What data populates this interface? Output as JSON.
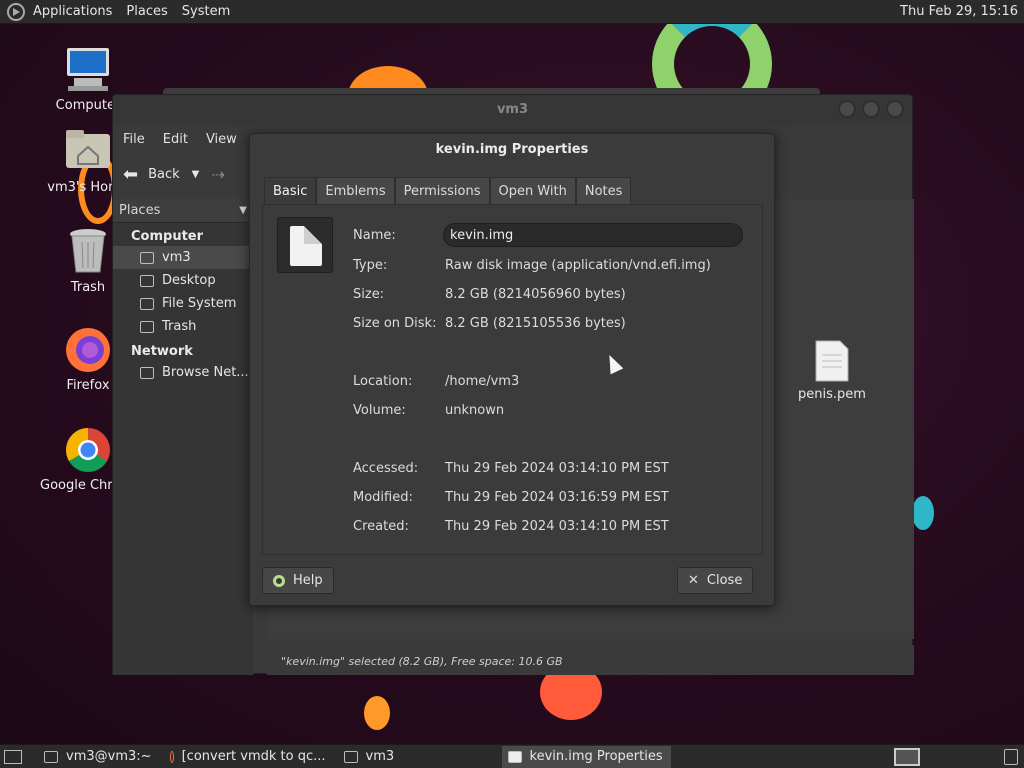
{
  "top_panel": {
    "menus": [
      "Applications",
      "Places",
      "System"
    ],
    "clock": "Thu Feb 29, 15:16"
  },
  "desktop_icons": [
    {
      "label": "Computer",
      "icon": "computer-icon"
    },
    {
      "label": "vm3's Home",
      "icon": "home-folder-icon"
    },
    {
      "label": "Trash",
      "icon": "trash-icon"
    },
    {
      "label": "Firefox",
      "icon": "firefox-icon"
    },
    {
      "label": "Google Chrome",
      "icon": "chrome-icon"
    }
  ],
  "file_manager": {
    "title": "vm3",
    "menu": [
      "File",
      "Edit",
      "View"
    ],
    "back_label": "Back",
    "places_label": "Places",
    "sidebar": {
      "computer_group": "Computer",
      "computer_items": [
        "vm3",
        "Desktop",
        "File System",
        "Trash"
      ],
      "network_group": "Network",
      "network_items": [
        "Browse Net..."
      ]
    },
    "files": [
      {
        "name": "penis.pem"
      }
    ],
    "status": "\"kevin.img\" selected (8.2 GB), Free space: 10.6 GB"
  },
  "dialog": {
    "title": "kevin.img Properties",
    "tabs": [
      "Basic",
      "Emblems",
      "Permissions",
      "Open With",
      "Notes"
    ],
    "active_tab": "Basic",
    "labels": {
      "name": "Name:",
      "type": "Type:",
      "size": "Size:",
      "size_on_disk": "Size on Disk:",
      "location": "Location:",
      "volume": "Volume:",
      "accessed": "Accessed:",
      "modified": "Modified:",
      "created": "Created:"
    },
    "values": {
      "name": "kevin.img",
      "type": "Raw disk image (application/vnd.efi.img)",
      "size": "8.2 GB (8214056960 bytes)",
      "size_on_disk": "8.2 GB (8215105536 bytes)",
      "location": "/home/vm3",
      "volume": "unknown",
      "accessed": "Thu 29 Feb 2024 03:14:10 PM EST",
      "modified": "Thu 29 Feb 2024 03:16:59 PM EST",
      "created": "Thu 29 Feb 2024 03:14:10 PM EST"
    },
    "help_label": "Help",
    "close_label": "Close"
  },
  "taskbar": {
    "tasks": [
      {
        "label": "vm3@vm3:~",
        "active": false
      },
      {
        "label": "[convert vmdk to qc...",
        "active": false
      },
      {
        "label": "vm3",
        "active": false
      },
      {
        "label": "kevin.img Properties",
        "active": true
      }
    ]
  }
}
